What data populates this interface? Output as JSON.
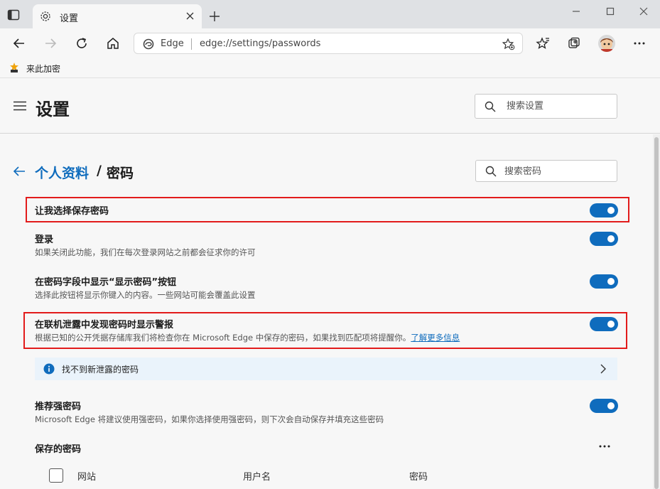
{
  "browser": {
    "tab_title": "设置",
    "address_prefix": "Edge",
    "url": "edge://settings/passwords"
  },
  "favorites_bar": {
    "item_label": "来此加密"
  },
  "settings": {
    "title": "设置",
    "search_placeholder": "搜索设置"
  },
  "breadcrumb": {
    "parent": "个人资料",
    "separator": "/",
    "current": "密码"
  },
  "password_search_placeholder": "搜索密码",
  "options": [
    {
      "title": "让我选择保存密码",
      "desc": "",
      "enabled": true
    },
    {
      "title": "登录",
      "desc": "如果关闭此功能，我们在每次登录网站之前都会征求你的许可",
      "enabled": true
    },
    {
      "title": "在密码字段中显示“显示密码”按钮",
      "desc": "选择此按钮将显示你键入的内容。一些网站可能会覆盖此设置",
      "enabled": true
    },
    {
      "title": "在联机泄露中发现密码时显示警报",
      "desc": "根据已知的公开凭据存储库我们将检查你在 Microsoft Edge 中保存的密码，如果找到匹配项将提醒你。",
      "link": "了解更多信息",
      "enabled": true
    },
    {
      "title": "推荐强密码",
      "desc": "Microsoft Edge 将建议使用强密码，如果你选择使用强密码，则下次会自动保存并填充这些密码",
      "enabled": true
    }
  ],
  "leak_info": {
    "text": "找不到新泄露的密码"
  },
  "saved_passwords": {
    "title": "保存的密码",
    "columns": [
      "网站",
      "用户名",
      "密码"
    ]
  },
  "colors": {
    "accent": "#0f6cbd",
    "highlight_border": "#e21b1b",
    "info_bg": "#eaf3fb"
  }
}
